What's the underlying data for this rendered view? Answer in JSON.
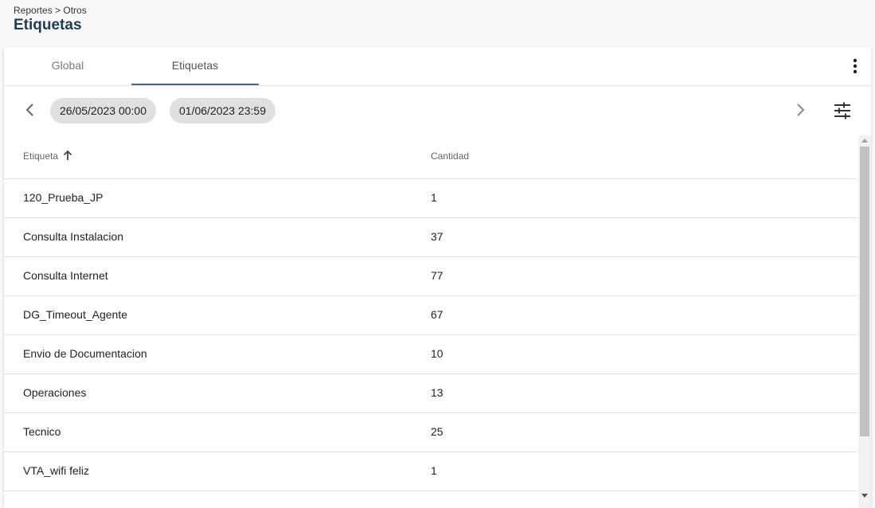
{
  "header": {
    "breadcrumb": "Reportes > Otros",
    "title": "Etiquetas"
  },
  "tabs": [
    {
      "label": "Global",
      "active": false
    },
    {
      "label": "Etiquetas",
      "active": true
    }
  ],
  "toolbar": {
    "date_from": "26/05/2023 00:00",
    "date_to": "01/06/2023 23:59",
    "prev_icon": "chevron-left-icon",
    "next_icon": "chevron-right-icon",
    "filter_icon": "tune-icon",
    "more_icon": "more-vert-icon"
  },
  "table": {
    "columns": [
      "Etiqueta",
      "Cantidad"
    ],
    "sort": {
      "column": "Etiqueta",
      "direction": "asc",
      "icon": "arrow-up-icon"
    },
    "rows": [
      {
        "label": "120_Prueba_JP",
        "count": "1"
      },
      {
        "label": "Consulta Instalacion",
        "count": "37"
      },
      {
        "label": "Consulta Internet",
        "count": "77"
      },
      {
        "label": "DG_Timeout_Agente",
        "count": "67"
      },
      {
        "label": "Envio de Documentacion",
        "count": "10"
      },
      {
        "label": "Operaciones",
        "count": "13"
      },
      {
        "label": "Tecnico",
        "count": "25"
      },
      {
        "label": "VTA_wifi feliz",
        "count": "1"
      }
    ]
  },
  "colors": {
    "title": "#1f3b57",
    "tab_indicator": "#4a6a84",
    "chip_background": "#e0e0e0"
  }
}
